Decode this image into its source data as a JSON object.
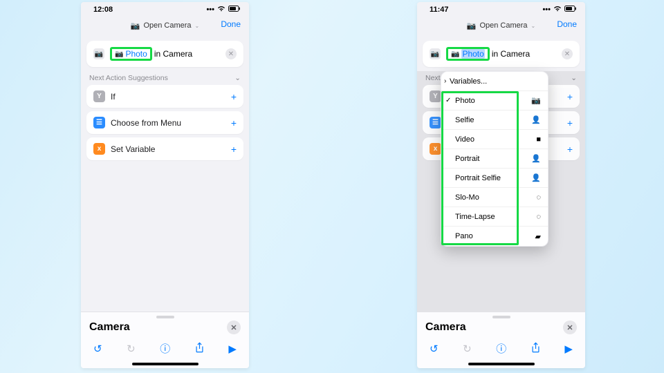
{
  "left": {
    "time": "12:08",
    "header": {
      "open_label": "Open Camera",
      "done": "Done"
    },
    "card": {
      "token_label": "Photo",
      "tail": "in Camera"
    },
    "section": "Next Action Suggestions",
    "rows": [
      {
        "label": "If"
      },
      {
        "label": "Choose from Menu"
      },
      {
        "label": "Set Variable"
      }
    ],
    "bottom_title": "Camera"
  },
  "right": {
    "time": "11:47",
    "header": {
      "open_label": "Open Camera",
      "done": "Done"
    },
    "card": {
      "token_label": "Photo",
      "tail": "in Camera"
    },
    "section_short": "Next",
    "bottom_title": "Camera",
    "popup": {
      "variables": "Variables...",
      "items": [
        {
          "label": "Photo",
          "icon": "📷",
          "checked": true
        },
        {
          "label": "Selfie",
          "icon": "👤"
        },
        {
          "label": "Video",
          "icon": "■"
        },
        {
          "label": "Portrait",
          "icon": "👤"
        },
        {
          "label": "Portrait Selfie",
          "icon": "👤"
        },
        {
          "label": "Slo-Mo",
          "icon": "◌"
        },
        {
          "label": "Time-Lapse",
          "icon": "◌"
        },
        {
          "label": "Pano",
          "icon": "▰"
        }
      ]
    }
  }
}
